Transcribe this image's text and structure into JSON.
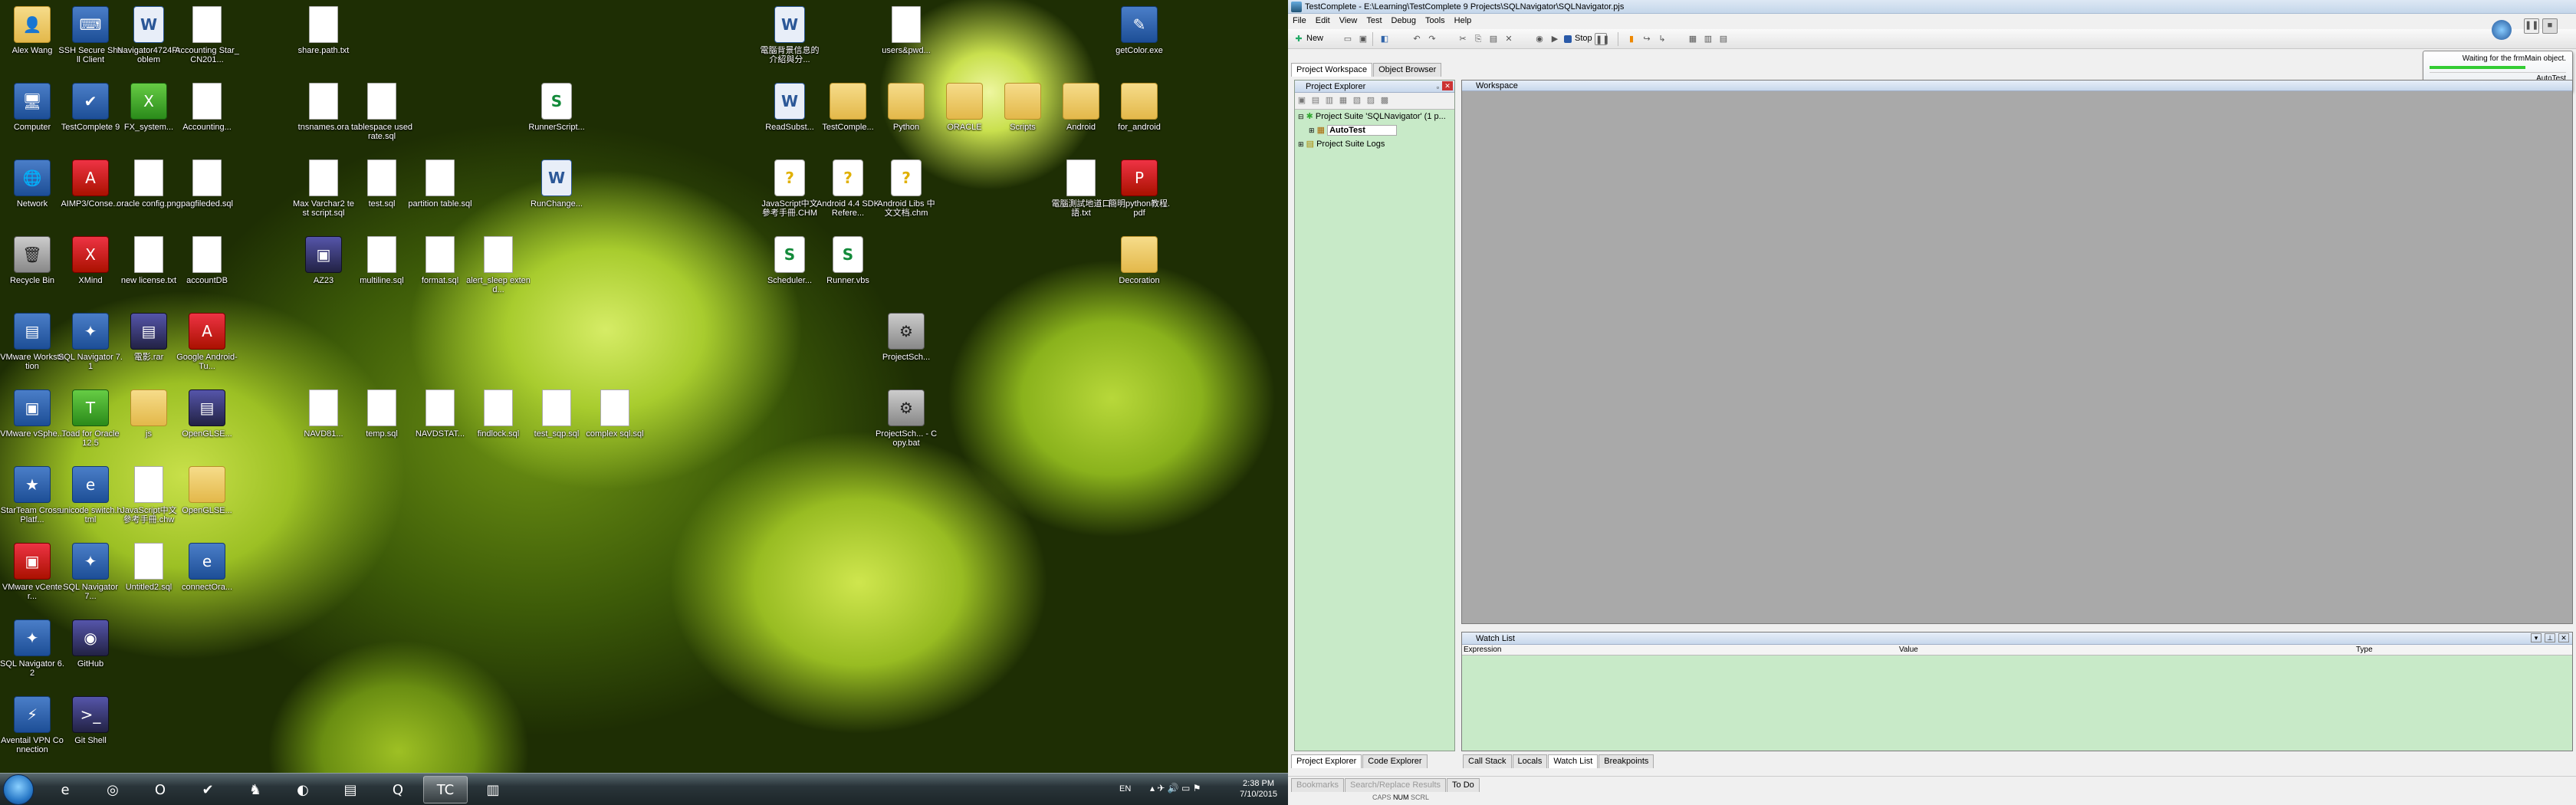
{
  "desktop": {
    "icons": [
      {
        "label": "Alex Wang",
        "kind": "folder",
        "glyph": "👤"
      },
      {
        "label": "SSH Secure Shell Client",
        "kind": "app",
        "glyph": "⌨"
      },
      {
        "label": "Navigator4724Problem",
        "kind": "word",
        "glyph": "W"
      },
      {
        "label": "Accounting Star_CN201...",
        "kind": "doc",
        "glyph": ""
      },
      {
        "label": "share.path.txt",
        "kind": "doc",
        "glyph": ""
      },
      {
        "label": "電腦背景信息的介紹與分...",
        "kind": "word",
        "glyph": "W"
      },
      {
        "label": "users&pwd...",
        "kind": "doc",
        "glyph": ""
      },
      {
        "label": "getColor.exe",
        "kind": "app",
        "glyph": "✎"
      },
      {
        "label": "Computer",
        "kind": "app",
        "glyph": "🖥"
      },
      {
        "label": "TestComplete 9",
        "kind": "app",
        "glyph": "✔"
      },
      {
        "label": "FX_system...",
        "kind": "green",
        "glyph": "X"
      },
      {
        "label": "Accounting...",
        "kind": "doc",
        "glyph": ""
      },
      {
        "label": "tnsnames.ora",
        "kind": "doc",
        "glyph": ""
      },
      {
        "label": "tablespace used rate.sql",
        "kind": "doc",
        "glyph": ""
      },
      {
        "label": "RunnerScript...",
        "kind": "script",
        "glyph": "S"
      },
      {
        "label": "ReadSubst...",
        "kind": "word",
        "glyph": "W"
      },
      {
        "label": "TestComple...",
        "kind": "folder",
        "glyph": ""
      },
      {
        "label": "Python",
        "kind": "folder",
        "glyph": ""
      },
      {
        "label": "ORACLE",
        "kind": "folder",
        "glyph": ""
      },
      {
        "label": "Scripts",
        "kind": "folder",
        "glyph": ""
      },
      {
        "label": "Android",
        "kind": "folder",
        "glyph": ""
      },
      {
        "label": "for_android",
        "kind": "folder",
        "glyph": ""
      },
      {
        "label": "Network",
        "kind": "app",
        "glyph": "🌐"
      },
      {
        "label": "AIMP3/Conse...",
        "kind": "red",
        "glyph": "A"
      },
      {
        "label": "oracle config.png",
        "kind": "doc",
        "glyph": ""
      },
      {
        "label": "pagfileded.sql",
        "kind": "doc",
        "glyph": ""
      },
      {
        "label": "Max Varchar2 test script.sql",
        "kind": "doc",
        "glyph": ""
      },
      {
        "label": "test.sql",
        "kind": "doc",
        "glyph": ""
      },
      {
        "label": "partition table.sql",
        "kind": "doc",
        "glyph": ""
      },
      {
        "label": "RunChange...",
        "kind": "word",
        "glyph": "W"
      },
      {
        "label": "JavaScript中文參考手冊.CHM",
        "kind": "help",
        "glyph": "?"
      },
      {
        "label": "Android 4.4 SDK Refere...",
        "kind": "help",
        "glyph": "?"
      },
      {
        "label": "Android Libs 中文文档.chm",
        "kind": "help",
        "glyph": "?"
      },
      {
        "label": "電腦測試地道口語.txt",
        "kind": "doc",
        "glyph": ""
      },
      {
        "label": "簡明python教程.pdf",
        "kind": "red",
        "glyph": "P"
      },
      {
        "label": "Recycle Bin",
        "kind": "gray",
        "glyph": "🗑"
      },
      {
        "label": "XMind",
        "kind": "red",
        "glyph": "X"
      },
      {
        "label": "new license.txt",
        "kind": "doc",
        "glyph": ""
      },
      {
        "label": "accountDB",
        "kind": "doc",
        "glyph": ""
      },
      {
        "label": "AZ23",
        "kind": "purple",
        "glyph": "▣"
      },
      {
        "label": "multiline.sql",
        "kind": "doc",
        "glyph": ""
      },
      {
        "label": "format.sql",
        "kind": "doc",
        "glyph": ""
      },
      {
        "label": "alert_sleep extend...",
        "kind": "doc",
        "glyph": ""
      },
      {
        "label": "Scheduler...",
        "kind": "script",
        "glyph": "S"
      },
      {
        "label": "Runner.vbs",
        "kind": "script",
        "glyph": "S"
      },
      {
        "label": "Decoration",
        "kind": "folder",
        "glyph": ""
      },
      {
        "label": "VMware Workstation",
        "kind": "app",
        "glyph": "▤"
      },
      {
        "label": "SQL Navigator 7.1",
        "kind": "app",
        "glyph": "✦"
      },
      {
        "label": "電影.rar",
        "kind": "purple",
        "glyph": "▤"
      },
      {
        "label": "Google Android-Tu...",
        "kind": "red",
        "glyph": "A"
      },
      {
        "label": "ProjectSch...",
        "kind": "gray",
        "glyph": "⚙"
      },
      {
        "label": "VMware vSphe...",
        "kind": "app",
        "glyph": "▣"
      },
      {
        "label": "Toad for Oracle 12.5",
        "kind": "green",
        "glyph": "T"
      },
      {
        "label": "js",
        "kind": "folder",
        "glyph": ""
      },
      {
        "label": "OpenGLSE...",
        "kind": "purple",
        "glyph": "▤"
      },
      {
        "label": "NAVD81...",
        "kind": "doc",
        "glyph": ""
      },
      {
        "label": "temp.sql",
        "kind": "doc",
        "glyph": ""
      },
      {
        "label": "NAVDSTAT...",
        "kind": "doc",
        "glyph": ""
      },
      {
        "label": "findlock.sql",
        "kind": "doc",
        "glyph": ""
      },
      {
        "label": "test_sqp.sql",
        "kind": "doc",
        "glyph": ""
      },
      {
        "label": "complex sql.sql",
        "kind": "doc",
        "glyph": ""
      },
      {
        "label": "ProjectSch... - Copy.bat",
        "kind": "gray",
        "glyph": "⚙"
      },
      {
        "label": "StarTeam Cross-Platf...",
        "kind": "app",
        "glyph": "★"
      },
      {
        "label": "unicode switch.html",
        "kind": "app",
        "glyph": "e"
      },
      {
        "label": "JavaScript中文參考手冊.chw",
        "kind": "doc",
        "glyph": ""
      },
      {
        "label": "OpenGLSE...",
        "kind": "folder",
        "glyph": ""
      },
      {
        "label": "VMware vCenter...",
        "kind": "red",
        "glyph": "▣"
      },
      {
        "label": "SQL Navigator 7...",
        "kind": "app",
        "glyph": "✦"
      },
      {
        "label": "Untitled2.sql",
        "kind": "doc",
        "glyph": ""
      },
      {
        "label": "connectOra...",
        "kind": "app",
        "glyph": "e"
      },
      {
        "label": "SQL Navigator 6.2",
        "kind": "app",
        "glyph": "✦"
      },
      {
        "label": "GitHub",
        "kind": "purple",
        "glyph": "◉"
      },
      {
        "label": "Aventail VPN Connection",
        "kind": "app",
        "glyph": "⚡"
      },
      {
        "label": "Git Shell",
        "kind": "purple",
        "glyph": ">_"
      }
    ]
  },
  "taskbar": {
    "apps": [
      {
        "name": "ie",
        "glyph": "e"
      },
      {
        "name": "chrome",
        "glyph": "◎"
      },
      {
        "name": "outlook",
        "glyph": "O"
      },
      {
        "name": "testcomplete-task",
        "glyph": "✔"
      },
      {
        "name": "qq",
        "glyph": "♞"
      },
      {
        "name": "media",
        "glyph": "◐"
      },
      {
        "name": "notepad",
        "glyph": "▤"
      },
      {
        "name": "q-app",
        "glyph": "Q"
      },
      {
        "name": "tc9",
        "glyph": "TC"
      },
      {
        "name": "explorer",
        "glyph": "▥"
      }
    ],
    "lang": "EN",
    "time": "2:38 PM",
    "date": "7/10/2015"
  },
  "app": {
    "title": "TestComplete - E:\\Learning\\TestComplete 9 Projects\\SQLNavigator\\SQLNavigator.pjs",
    "menu": [
      "File",
      "Edit",
      "View",
      "Test",
      "Debug",
      "Tools",
      "Help"
    ],
    "toolbar": {
      "new_label": "New",
      "stop_label": "Stop"
    },
    "tabs_top": [
      "Project Workspace",
      "Object Browser"
    ],
    "project_explorer": {
      "title": "Project Explorer",
      "suite": "Project Suite 'SQLNavigator' (1 p...",
      "project": "AutoTest",
      "logs": "Project Suite Logs"
    },
    "tabs_left_bottom": [
      "Project Explorer",
      "Code Explorer"
    ],
    "workspace_title": "Workspace",
    "watch": {
      "title": "Watch List",
      "columns": [
        "Expression",
        "Value",
        "Type"
      ]
    },
    "tabs_bottom": [
      "Call Stack",
      "Locals",
      "Watch List",
      "Breakpoints"
    ],
    "status_tabs": [
      "Bookmarks",
      "Search/Replace Results",
      "To Do"
    ],
    "status_keys": [
      "CAPS",
      "NUM",
      "SCRL"
    ],
    "tooltip": {
      "message": "Waiting for the frmMain object.",
      "project": "AutoTest"
    }
  }
}
